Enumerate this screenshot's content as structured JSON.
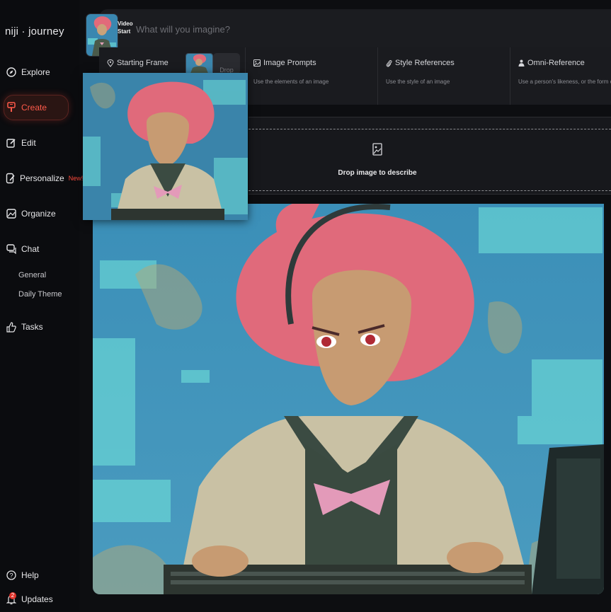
{
  "app": {
    "brand": "niji · journey"
  },
  "sidebar": {
    "items": [
      {
        "label": "Explore",
        "icon": "compass-icon"
      },
      {
        "label": "Create",
        "icon": "brush-icon",
        "active": true
      },
      {
        "label": "Edit",
        "icon": "edit-icon"
      },
      {
        "label": "Personalize",
        "icon": "personalize-icon",
        "tag": "New!"
      },
      {
        "label": "Organize",
        "icon": "image-folder-icon"
      },
      {
        "label": "Chat",
        "icon": "chat-icon"
      },
      {
        "label": "Tasks",
        "icon": "thumbs-up-icon"
      }
    ],
    "chat_channels": [
      "General",
      "Daily Theme"
    ],
    "help": "Help",
    "updates": "Updates",
    "updates_count": "2"
  },
  "prompt": {
    "placeholder": "What will you imagine?",
    "video_label_1": "Video",
    "video_label_2": "Start"
  },
  "references": {
    "starting_frame": "Starting Frame",
    "drop": "Drop",
    "columns": [
      {
        "title": "Image Prompts",
        "desc": "Use the elements of an image",
        "icon": "image-icon"
      },
      {
        "title": "Style References",
        "desc": "Use the style of an image",
        "icon": "paperclip-icon"
      },
      {
        "title": "Omni-Reference",
        "desc": "Use a person's likeness, or the form of an",
        "icon": "person-icon"
      }
    ]
  },
  "describe": {
    "label": "Drop image to describe"
  },
  "colors": {
    "accent": "#ff4a3c",
    "background": "#0d0e11",
    "panel": "#1b1c20"
  }
}
